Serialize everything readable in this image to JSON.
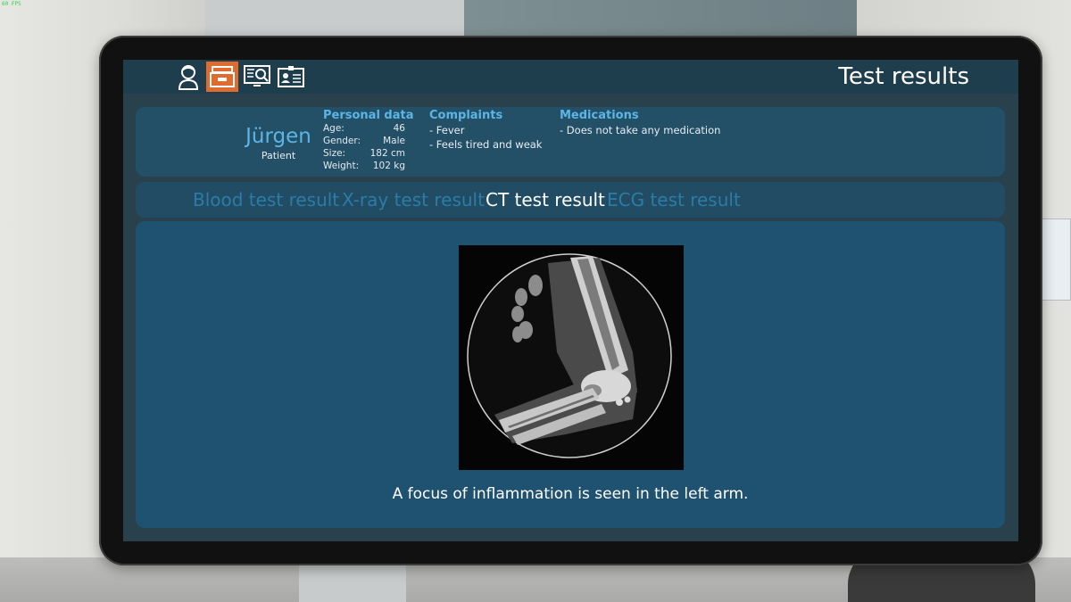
{
  "overlay": {
    "fps": "60 FPS"
  },
  "header": {
    "title": "Test results",
    "nav": [
      {
        "name": "patient-nav-icon",
        "icon": "nurse-icon",
        "active": false
      },
      {
        "name": "records-nav-icon",
        "icon": "file-drawer-icon",
        "active": true
      },
      {
        "name": "monitor-nav-icon",
        "icon": "monitor-search-icon",
        "active": false
      },
      {
        "name": "idcard-nav-icon",
        "icon": "id-card-icon",
        "active": false
      }
    ]
  },
  "patient": {
    "name": "Jürgen",
    "role": "Patient",
    "personal_data": {
      "heading": "Personal data",
      "rows": [
        {
          "key": "Age:",
          "value": "46"
        },
        {
          "key": "Gender:",
          "value": "Male"
        },
        {
          "key": "Size:",
          "value": "182 cm"
        },
        {
          "key": "Weight:",
          "value": "102 kg"
        }
      ]
    },
    "complaints": {
      "heading": "Complaints",
      "items": [
        "- Fever",
        "- Feels tired and weak"
      ]
    },
    "medications": {
      "heading": "Medications",
      "items": [
        "- Does not take any medication"
      ]
    }
  },
  "tabs": [
    {
      "label": "Blood test result",
      "active": false
    },
    {
      "label": "X-ray test result",
      "active": false
    },
    {
      "label": "CT test result",
      "active": true
    },
    {
      "label": "ECG test result",
      "active": false
    }
  ],
  "result": {
    "caption": "A focus of inflammation is seen in the left arm."
  },
  "colors": {
    "accent": "#e06b2f",
    "heading_blue": "#5bb6e6",
    "inactive_tab": "#2b7ca6",
    "panel": "#1f5271"
  }
}
